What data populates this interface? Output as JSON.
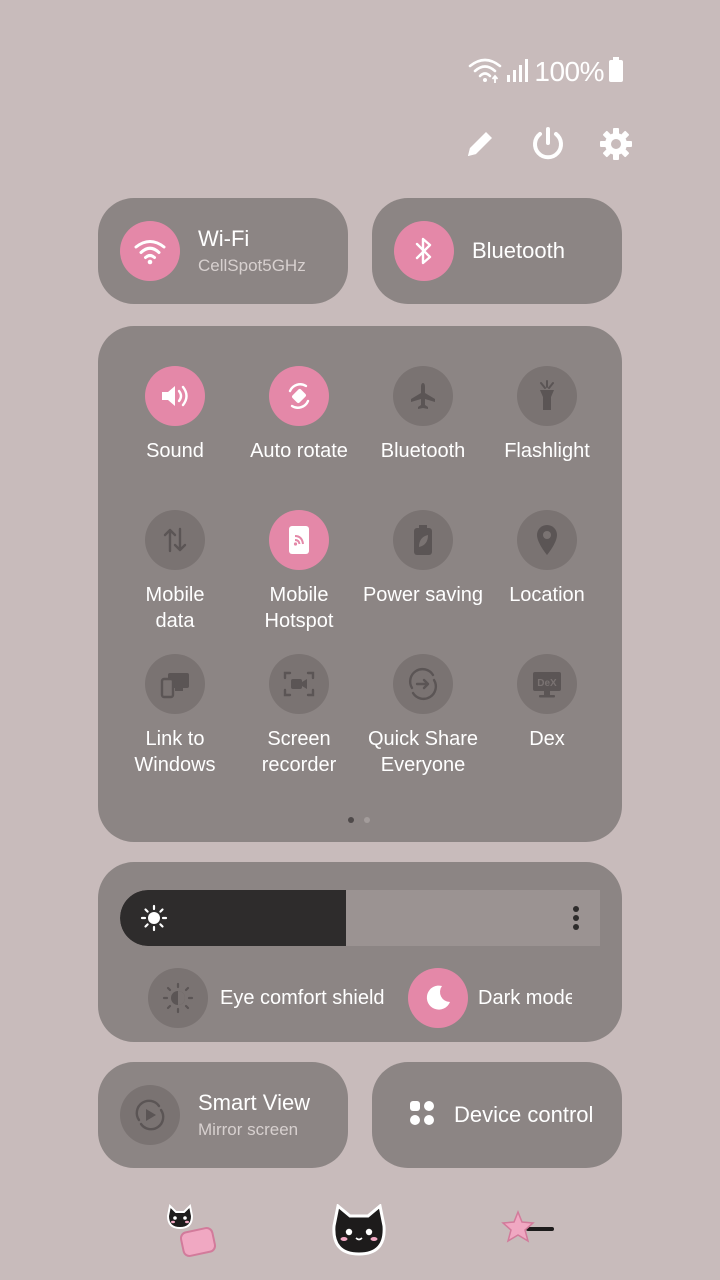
{
  "status_bar": {
    "battery_text": "100%",
    "icons": [
      "wifi-icon",
      "signal-icon",
      "battery-icon"
    ]
  },
  "top_actions": [
    "edit-icon",
    "power-icon",
    "settings-icon"
  ],
  "wifi_tile": {
    "title": "Wi-Fi",
    "subtitle": "CellSpot5GHz",
    "active": true
  },
  "bluetooth_tile": {
    "title": "Bluetooth",
    "active": true
  },
  "tiles": [
    {
      "label": "Sound",
      "icon": "sound-icon",
      "active": true
    },
    {
      "label": "Auto rotate",
      "icon": "auto-rotate-icon",
      "active": true
    },
    {
      "label": "Bluetooth",
      "icon": "airplane-icon",
      "active": false
    },
    {
      "label": "Flashlight",
      "icon": "flashlight-icon",
      "active": false
    },
    {
      "label": "Mobile\ndata",
      "icon": "mobile-data-icon",
      "active": false
    },
    {
      "label": "Mobile\nHotspot",
      "icon": "hotspot-icon",
      "active": true
    },
    {
      "label": "Power saving",
      "icon": "power-saving-icon",
      "active": false
    },
    {
      "label": "Location",
      "icon": "location-icon",
      "active": false
    },
    {
      "label": "Link to\nWindows",
      "icon": "link-windows-icon",
      "active": false
    },
    {
      "label": "Screen\nrecorder",
      "icon": "screen-recorder-icon",
      "active": false
    },
    {
      "label": "Quick Share\nEveryone",
      "icon": "quick-share-icon",
      "active": false
    },
    {
      "label": "Dex",
      "icon": "dex-icon",
      "active": false
    }
  ],
  "pager": {
    "pages": 2,
    "current": 1
  },
  "brightness": {
    "level": 0.47,
    "eye_comfort_label": "Eye comfort shield",
    "eye_comfort_active": false,
    "dark_mode_label": "Dark mode",
    "dark_mode_active": true
  },
  "smart_view": {
    "title": "Smart View",
    "subtitle": "Mirror screen"
  },
  "device_control": {
    "title": "Device control"
  },
  "stickers": [
    "cat-pillow-sticker",
    "black-cat-sticker",
    "pink-star-sticker"
  ],
  "colors": {
    "background": "#c8bbbb",
    "panel": "#8c8584",
    "accent": "#e488a8",
    "inactive_circle": "#7a7372",
    "slider_fill": "#2e2c2c"
  },
  "dex_text": "DeX"
}
